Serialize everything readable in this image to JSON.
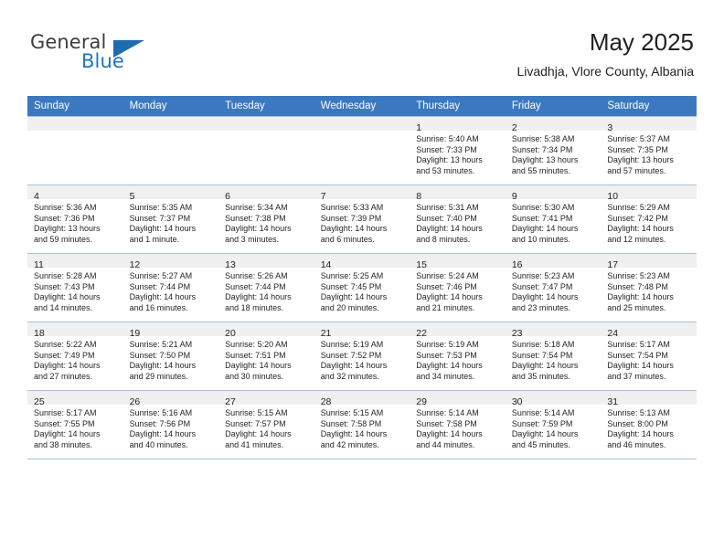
{
  "brand": {
    "word1": "General",
    "word2": "Blue",
    "flag_color": "#1d6cb0",
    "blue_color": "#1d76c4"
  },
  "header": {
    "month_title": "May 2025",
    "location": "Livadhja, Vlore County, Albania",
    "header_bg": "#3b78bf"
  },
  "weekday_headers": [
    "Sunday",
    "Monday",
    "Tuesday",
    "Wednesday",
    "Thursday",
    "Friday",
    "Saturday"
  ],
  "weeks": [
    [
      {
        "day": "",
        "sunrise": "",
        "sunset": "",
        "daylight1": "",
        "daylight2": ""
      },
      {
        "day": "",
        "sunrise": "",
        "sunset": "",
        "daylight1": "",
        "daylight2": ""
      },
      {
        "day": "",
        "sunrise": "",
        "sunset": "",
        "daylight1": "",
        "daylight2": ""
      },
      {
        "day": "",
        "sunrise": "",
        "sunset": "",
        "daylight1": "",
        "daylight2": ""
      },
      {
        "day": "1",
        "sunrise": "Sunrise: 5:40 AM",
        "sunset": "Sunset: 7:33 PM",
        "daylight1": "Daylight: 13 hours",
        "daylight2": "and 53 minutes."
      },
      {
        "day": "2",
        "sunrise": "Sunrise: 5:38 AM",
        "sunset": "Sunset: 7:34 PM",
        "daylight1": "Daylight: 13 hours",
        "daylight2": "and 55 minutes."
      },
      {
        "day": "3",
        "sunrise": "Sunrise: 5:37 AM",
        "sunset": "Sunset: 7:35 PM",
        "daylight1": "Daylight: 13 hours",
        "daylight2": "and 57 minutes."
      }
    ],
    [
      {
        "day": "4",
        "sunrise": "Sunrise: 5:36 AM",
        "sunset": "Sunset: 7:36 PM",
        "daylight1": "Daylight: 13 hours",
        "daylight2": "and 59 minutes."
      },
      {
        "day": "5",
        "sunrise": "Sunrise: 5:35 AM",
        "sunset": "Sunset: 7:37 PM",
        "daylight1": "Daylight: 14 hours",
        "daylight2": "and 1 minute."
      },
      {
        "day": "6",
        "sunrise": "Sunrise: 5:34 AM",
        "sunset": "Sunset: 7:38 PM",
        "daylight1": "Daylight: 14 hours",
        "daylight2": "and 3 minutes."
      },
      {
        "day": "7",
        "sunrise": "Sunrise: 5:33 AM",
        "sunset": "Sunset: 7:39 PM",
        "daylight1": "Daylight: 14 hours",
        "daylight2": "and 6 minutes."
      },
      {
        "day": "8",
        "sunrise": "Sunrise: 5:31 AM",
        "sunset": "Sunset: 7:40 PM",
        "daylight1": "Daylight: 14 hours",
        "daylight2": "and 8 minutes."
      },
      {
        "day": "9",
        "sunrise": "Sunrise: 5:30 AM",
        "sunset": "Sunset: 7:41 PM",
        "daylight1": "Daylight: 14 hours",
        "daylight2": "and 10 minutes."
      },
      {
        "day": "10",
        "sunrise": "Sunrise: 5:29 AM",
        "sunset": "Sunset: 7:42 PM",
        "daylight1": "Daylight: 14 hours",
        "daylight2": "and 12 minutes."
      }
    ],
    [
      {
        "day": "11",
        "sunrise": "Sunrise: 5:28 AM",
        "sunset": "Sunset: 7:43 PM",
        "daylight1": "Daylight: 14 hours",
        "daylight2": "and 14 minutes."
      },
      {
        "day": "12",
        "sunrise": "Sunrise: 5:27 AM",
        "sunset": "Sunset: 7:44 PM",
        "daylight1": "Daylight: 14 hours",
        "daylight2": "and 16 minutes."
      },
      {
        "day": "13",
        "sunrise": "Sunrise: 5:26 AM",
        "sunset": "Sunset: 7:44 PM",
        "daylight1": "Daylight: 14 hours",
        "daylight2": "and 18 minutes."
      },
      {
        "day": "14",
        "sunrise": "Sunrise: 5:25 AM",
        "sunset": "Sunset: 7:45 PM",
        "daylight1": "Daylight: 14 hours",
        "daylight2": "and 20 minutes."
      },
      {
        "day": "15",
        "sunrise": "Sunrise: 5:24 AM",
        "sunset": "Sunset: 7:46 PM",
        "daylight1": "Daylight: 14 hours",
        "daylight2": "and 21 minutes."
      },
      {
        "day": "16",
        "sunrise": "Sunrise: 5:23 AM",
        "sunset": "Sunset: 7:47 PM",
        "daylight1": "Daylight: 14 hours",
        "daylight2": "and 23 minutes."
      },
      {
        "day": "17",
        "sunrise": "Sunrise: 5:23 AM",
        "sunset": "Sunset: 7:48 PM",
        "daylight1": "Daylight: 14 hours",
        "daylight2": "and 25 minutes."
      }
    ],
    [
      {
        "day": "18",
        "sunrise": "Sunrise: 5:22 AM",
        "sunset": "Sunset: 7:49 PM",
        "daylight1": "Daylight: 14 hours",
        "daylight2": "and 27 minutes."
      },
      {
        "day": "19",
        "sunrise": "Sunrise: 5:21 AM",
        "sunset": "Sunset: 7:50 PM",
        "daylight1": "Daylight: 14 hours",
        "daylight2": "and 29 minutes."
      },
      {
        "day": "20",
        "sunrise": "Sunrise: 5:20 AM",
        "sunset": "Sunset: 7:51 PM",
        "daylight1": "Daylight: 14 hours",
        "daylight2": "and 30 minutes."
      },
      {
        "day": "21",
        "sunrise": "Sunrise: 5:19 AM",
        "sunset": "Sunset: 7:52 PM",
        "daylight1": "Daylight: 14 hours",
        "daylight2": "and 32 minutes."
      },
      {
        "day": "22",
        "sunrise": "Sunrise: 5:19 AM",
        "sunset": "Sunset: 7:53 PM",
        "daylight1": "Daylight: 14 hours",
        "daylight2": "and 34 minutes."
      },
      {
        "day": "23",
        "sunrise": "Sunrise: 5:18 AM",
        "sunset": "Sunset: 7:54 PM",
        "daylight1": "Daylight: 14 hours",
        "daylight2": "and 35 minutes."
      },
      {
        "day": "24",
        "sunrise": "Sunrise: 5:17 AM",
        "sunset": "Sunset: 7:54 PM",
        "daylight1": "Daylight: 14 hours",
        "daylight2": "and 37 minutes."
      }
    ],
    [
      {
        "day": "25",
        "sunrise": "Sunrise: 5:17 AM",
        "sunset": "Sunset: 7:55 PM",
        "daylight1": "Daylight: 14 hours",
        "daylight2": "and 38 minutes."
      },
      {
        "day": "26",
        "sunrise": "Sunrise: 5:16 AM",
        "sunset": "Sunset: 7:56 PM",
        "daylight1": "Daylight: 14 hours",
        "daylight2": "and 40 minutes."
      },
      {
        "day": "27",
        "sunrise": "Sunrise: 5:15 AM",
        "sunset": "Sunset: 7:57 PM",
        "daylight1": "Daylight: 14 hours",
        "daylight2": "and 41 minutes."
      },
      {
        "day": "28",
        "sunrise": "Sunrise: 5:15 AM",
        "sunset": "Sunset: 7:58 PM",
        "daylight1": "Daylight: 14 hours",
        "daylight2": "and 42 minutes."
      },
      {
        "day": "29",
        "sunrise": "Sunrise: 5:14 AM",
        "sunset": "Sunset: 7:58 PM",
        "daylight1": "Daylight: 14 hours",
        "daylight2": "and 44 minutes."
      },
      {
        "day": "30",
        "sunrise": "Sunrise: 5:14 AM",
        "sunset": "Sunset: 7:59 PM",
        "daylight1": "Daylight: 14 hours",
        "daylight2": "and 45 minutes."
      },
      {
        "day": "31",
        "sunrise": "Sunrise: 5:13 AM",
        "sunset": "Sunset: 8:00 PM",
        "daylight1": "Daylight: 14 hours",
        "daylight2": "and 46 minutes."
      }
    ]
  ]
}
